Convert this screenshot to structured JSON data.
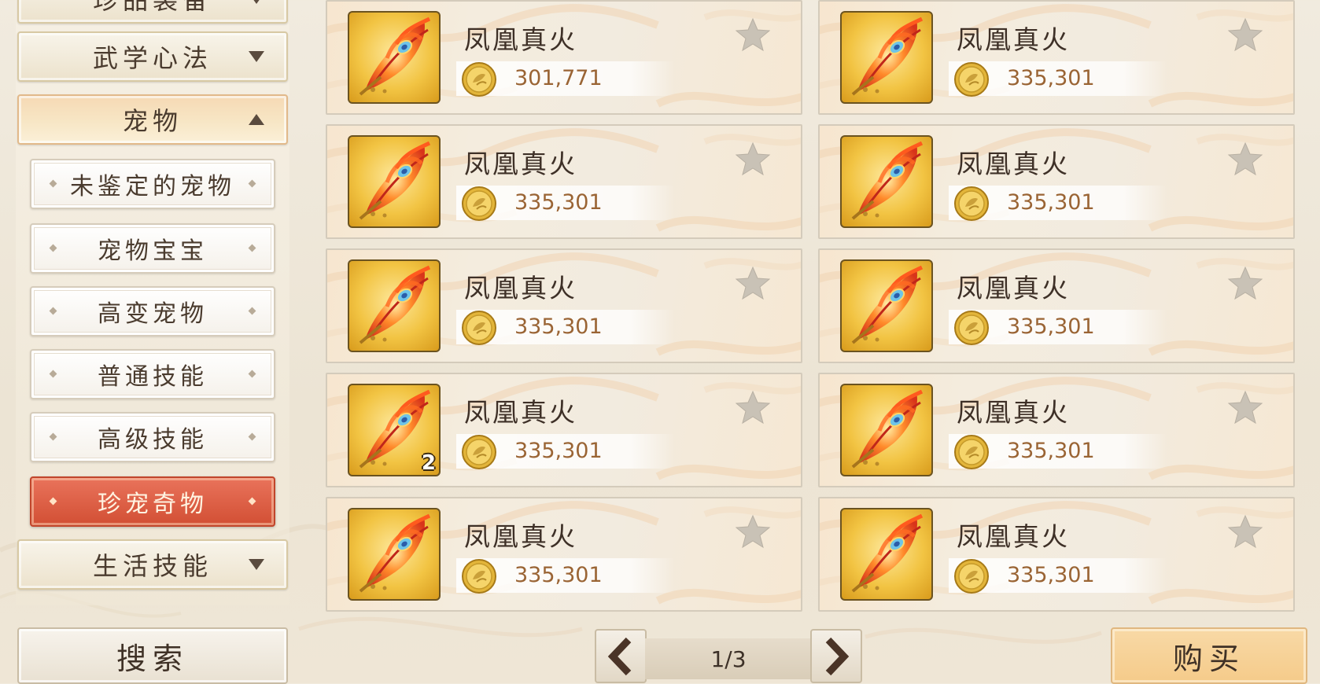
{
  "sidebar": {
    "categories": [
      {
        "label": "珍品装备",
        "state": "collapsed"
      },
      {
        "label": "武学心法",
        "state": "collapsed"
      },
      {
        "label": "宠物",
        "state": "expanded"
      },
      {
        "label": "生活技能",
        "state": "collapsed"
      }
    ],
    "pet_subitems": [
      {
        "label": "未鉴定的宠物",
        "active": false
      },
      {
        "label": "宠物宝宝",
        "active": false
      },
      {
        "label": "高变宠物",
        "active": false
      },
      {
        "label": "普通技能",
        "active": false
      },
      {
        "label": "高级技能",
        "active": false
      },
      {
        "label": "珍宠奇物",
        "active": true
      }
    ],
    "search_label": "搜索"
  },
  "items": [
    {
      "name": "凤凰真火",
      "price": "301,771",
      "qty": ""
    },
    {
      "name": "凤凰真火",
      "price": "335,301",
      "qty": ""
    },
    {
      "name": "凤凰真火",
      "price": "335,301",
      "qty": ""
    },
    {
      "name": "凤凰真火",
      "price": "335,301",
      "qty": ""
    },
    {
      "name": "凤凰真火",
      "price": "335,301",
      "qty": ""
    },
    {
      "name": "凤凰真火",
      "price": "335,301",
      "qty": ""
    },
    {
      "name": "凤凰真火",
      "price": "335,301",
      "qty": "2"
    },
    {
      "name": "凤凰真火",
      "price": "335,301",
      "qty": ""
    },
    {
      "name": "凤凰真火",
      "price": "335,301",
      "qty": ""
    },
    {
      "name": "凤凰真火",
      "price": "335,301",
      "qty": ""
    }
  ],
  "icons": {
    "item": "phoenix-feather-icon",
    "currency": "gold-coin-icon",
    "favorite": "star-icon",
    "prev": "chevron-left-icon",
    "next": "chevron-right-icon"
  },
  "pager": {
    "text": "1/3"
  },
  "buy_label": "购买",
  "colors": {
    "active_tab": "#d95a3f",
    "price_text": "#9a6434",
    "icon_frame": "#f2c443"
  }
}
